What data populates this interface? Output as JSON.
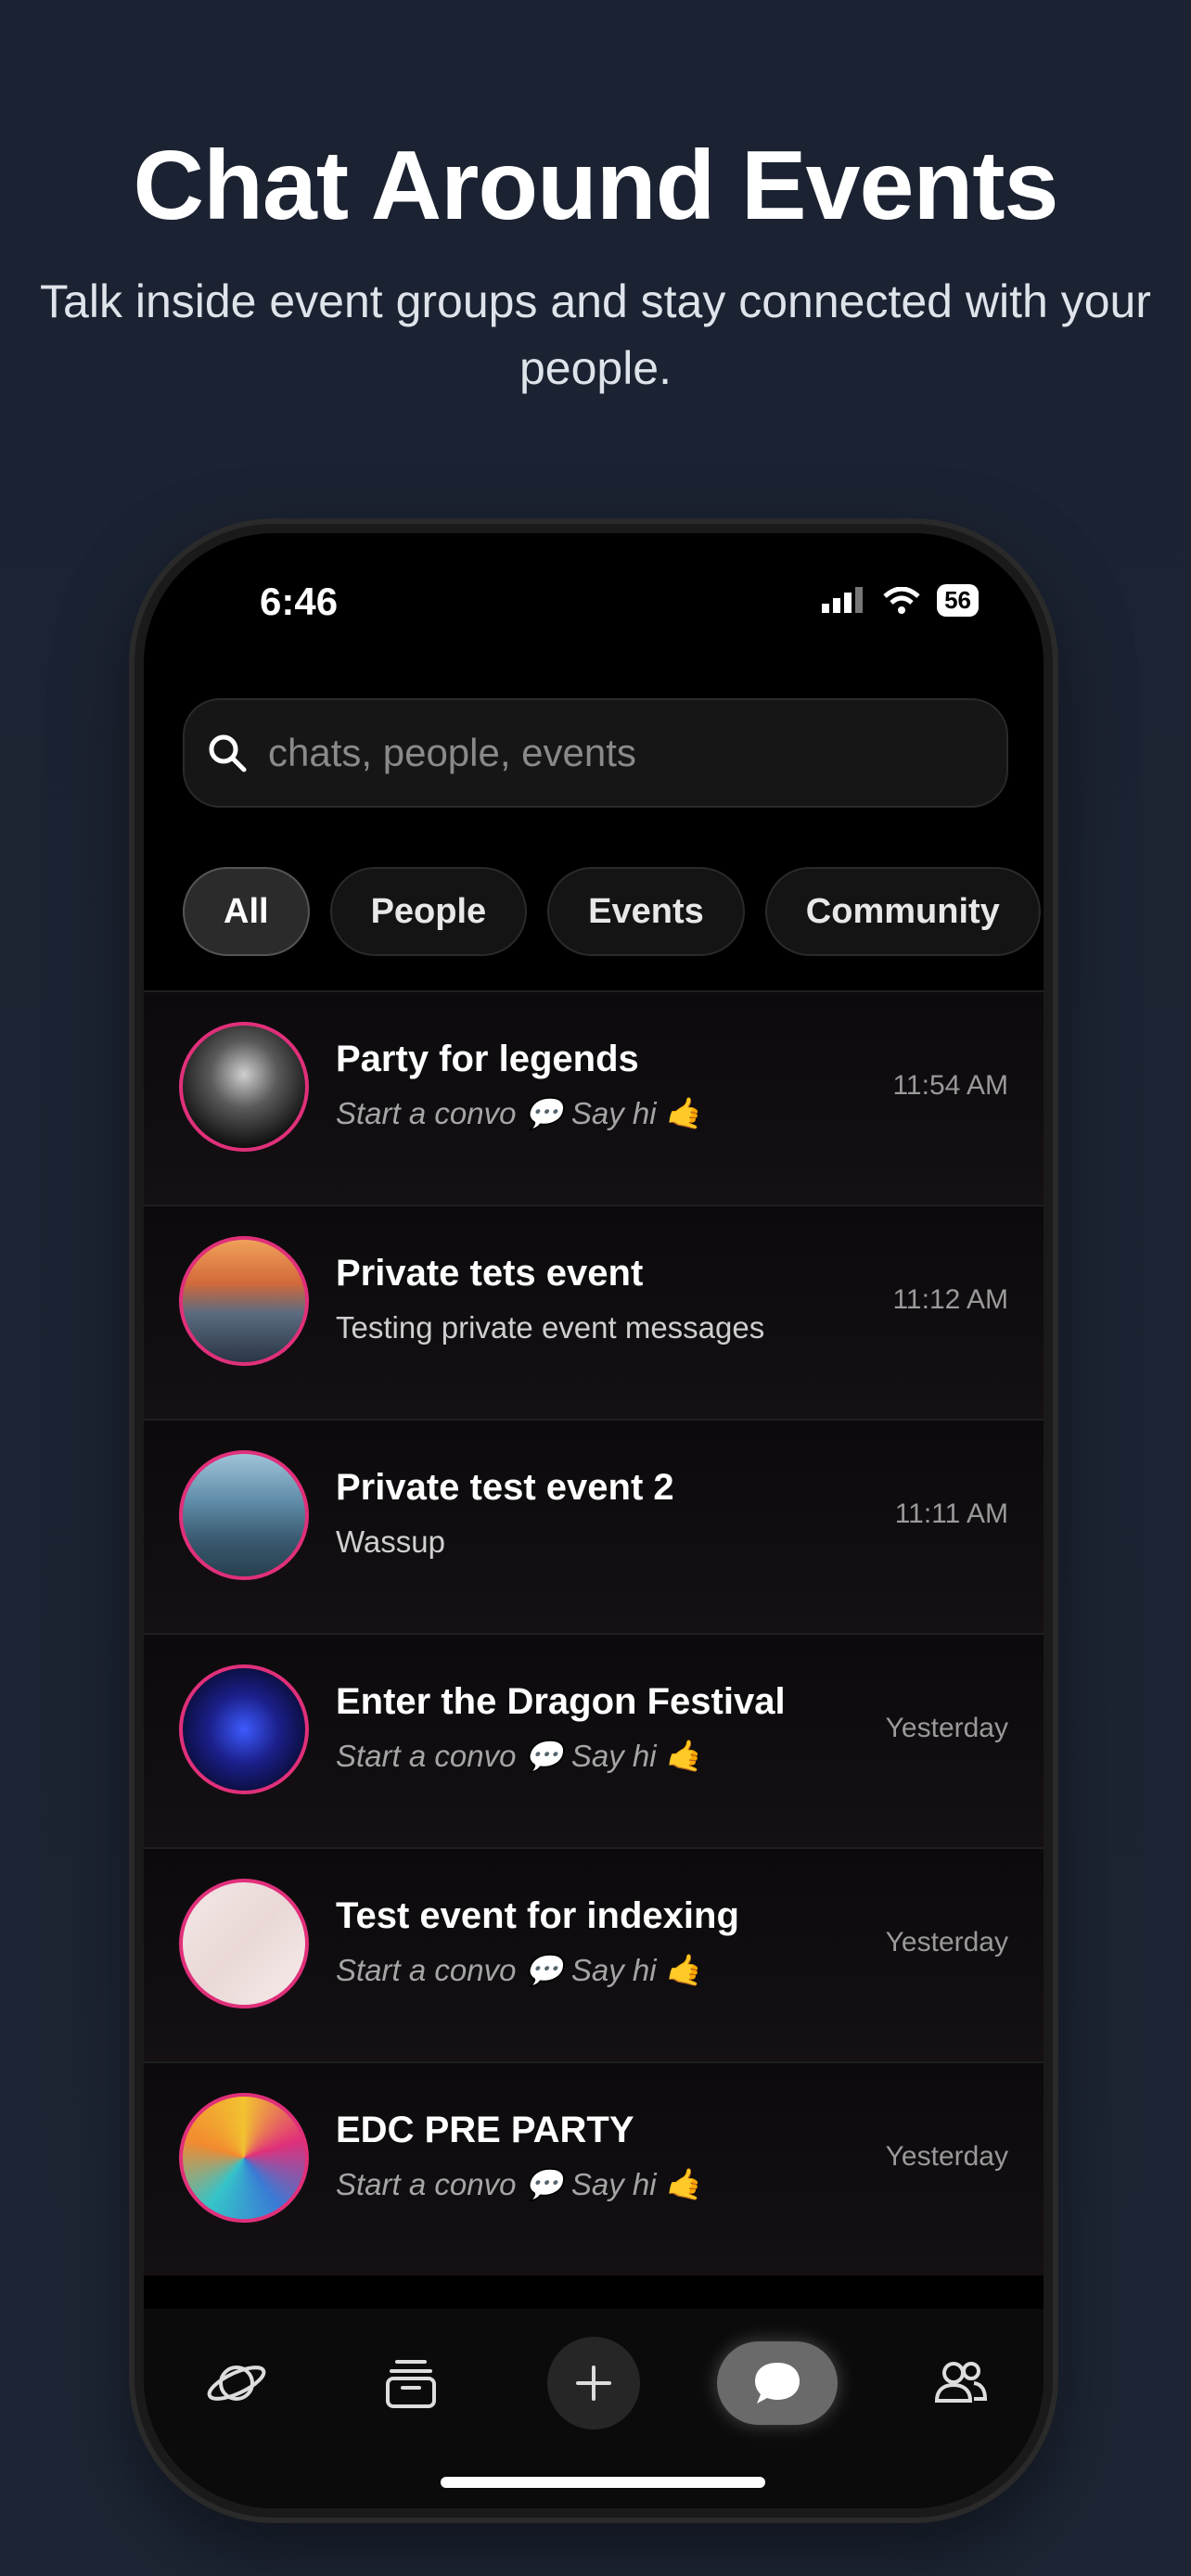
{
  "hero": {
    "title": "Chat Around Events",
    "subtitle": "Talk inside event groups and stay connected with your people."
  },
  "status": {
    "time": "6:46",
    "battery": "56"
  },
  "search": {
    "placeholder": "chats, people, events"
  },
  "filters": [
    "All",
    "People",
    "Events",
    "Community"
  ],
  "chats": [
    {
      "title": "Party for legends",
      "message": "Start a convo 💬 Say hi 🤙",
      "time": "11:54 AM"
    },
    {
      "title": "Private tets event",
      "message": "Testing private event messages",
      "time": "11:12 AM"
    },
    {
      "title": "Private test event 2",
      "message": "Wassup",
      "time": "11:11 AM"
    },
    {
      "title": "Enter the Dragon Festival",
      "message": "Start a convo 💬 Say hi 🤙",
      "time": "Yesterday"
    },
    {
      "title": "Test event for indexing",
      "message": "Start a convo 💬 Say hi 🤙",
      "time": "Yesterday"
    },
    {
      "title": "EDC PRE PARTY",
      "message": "Start a convo 💬 Say hi 🤙",
      "time": "Yesterday"
    }
  ],
  "tabbar": [
    "planet-icon",
    "inbox-icon",
    "plus-icon",
    "chat-icon",
    "people-icon"
  ],
  "colors": {
    "accent": "#e0307a",
    "background": "#1c2433"
  }
}
